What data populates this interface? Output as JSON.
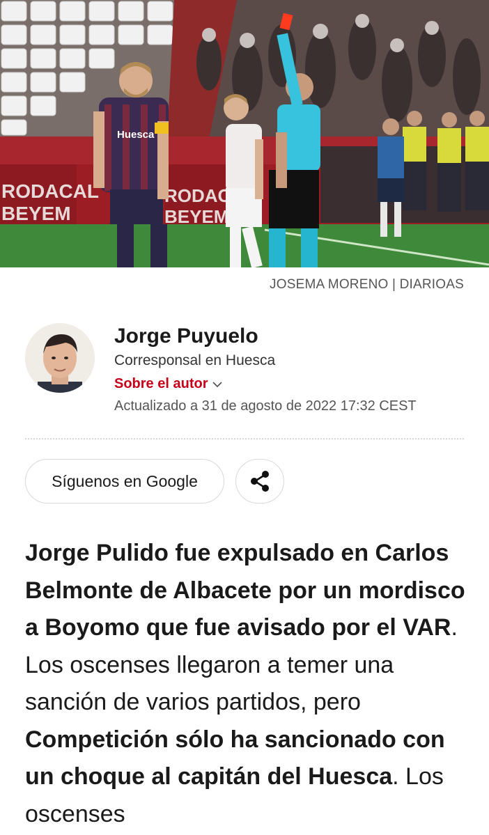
{
  "hero": {
    "banner_left": [
      "RODACAL",
      "BEYEM"
    ],
    "banner_right": [
      "RODACAL",
      "BEYEM"
    ],
    "shirt_sponsor": "Huesca",
    "credit": "JOSEMA MORENO | DIARIOAS"
  },
  "author": {
    "name": "Jorge Puyuelo",
    "role": "Corresponsal en Huesca",
    "about_label": "Sobre el autor",
    "updated": "Actualizado a 31 de agosto de 2022 17:32 CEST"
  },
  "actions": {
    "google_label": "Síguenos en Google",
    "share_icon": "share-icon"
  },
  "article": {
    "p1_b1": "Jorge Pulido fue expulsado en Carlos Belmonte de Albacete por un mordisco a Boyomo que fue avisado por el VAR",
    "p1_t1": ". Los oscenses llegaron a temer una sanción de varios partidos, pero ",
    "p1_b2": "Competición sólo ha sancionado con un choque al capitán del Huesca",
    "p1_t2": ". Los oscenses"
  },
  "colors": {
    "accent_red": "#c7001a",
    "pitch_green": "#3f8a3a",
    "stand_red": "#9c1d24"
  }
}
